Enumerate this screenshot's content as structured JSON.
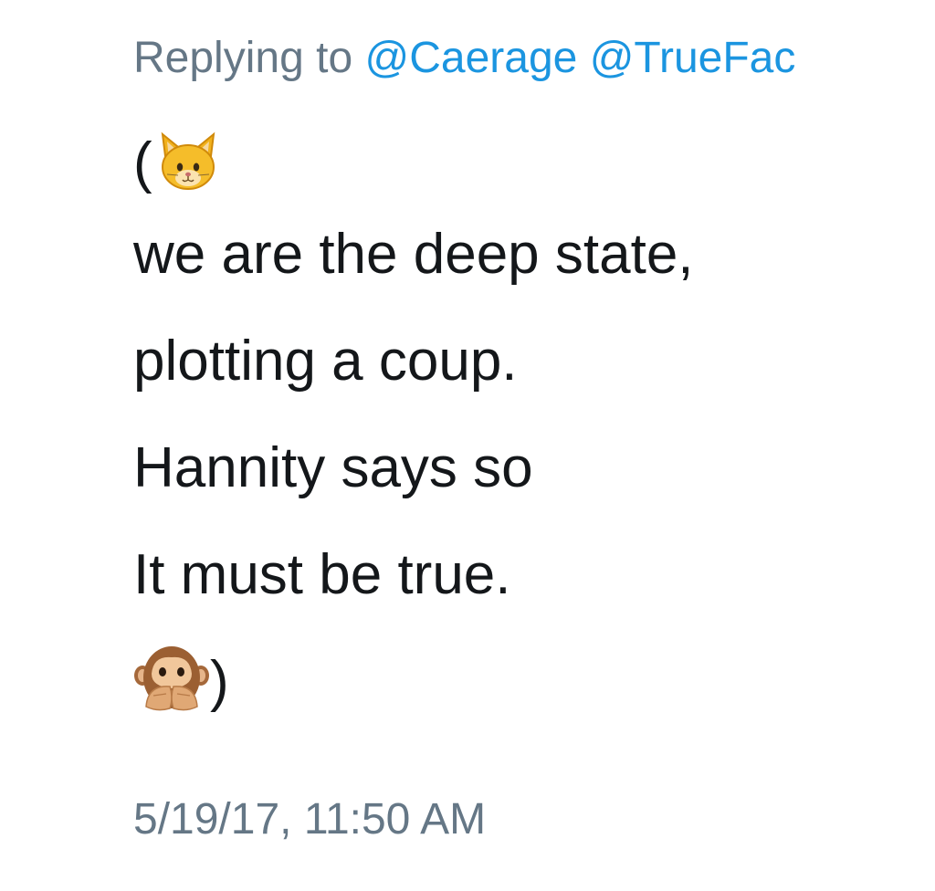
{
  "reply": {
    "prefix": "Replying to",
    "mentions": [
      "@Caerage",
      "@TrueFac"
    ]
  },
  "tweet": {
    "open_paren": "(",
    "lines": [
      "we are the deep state,",
      "plotting a coup.",
      "Hannity says so",
      "It must be true."
    ],
    "close_paren": ")",
    "emoji_start": "cat-face-emoji",
    "emoji_end": "speak-no-evil-monkey-emoji"
  },
  "timestamp": "5/19/17, 11:50 AM",
  "colors": {
    "link": "#1b95e0",
    "muted": "#657786",
    "text": "#14171a"
  }
}
